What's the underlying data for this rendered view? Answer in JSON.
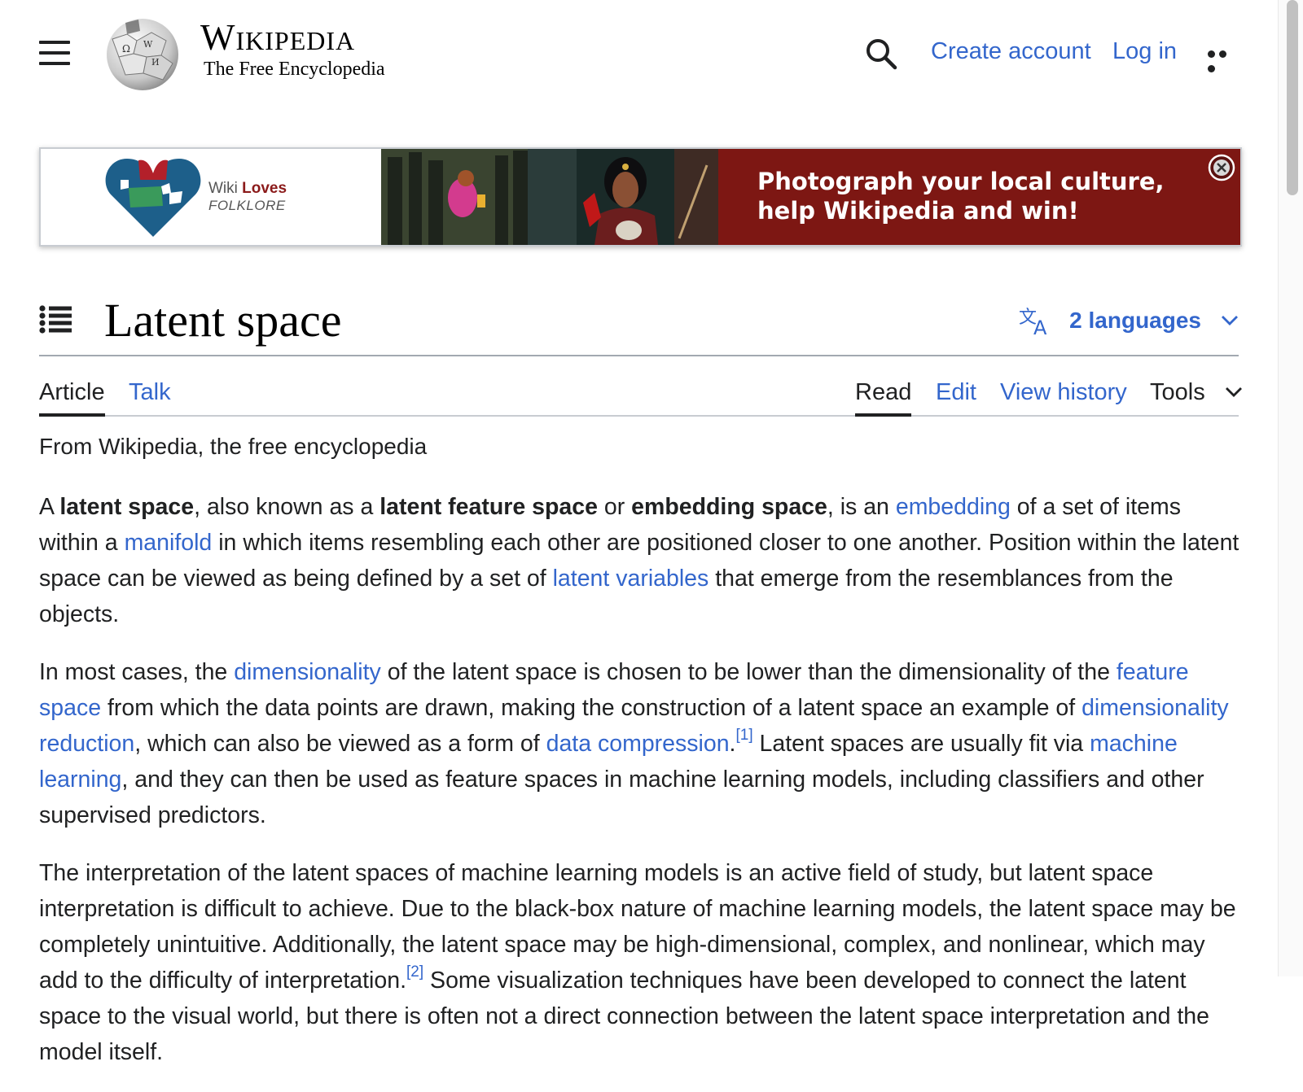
{
  "header": {
    "wordmark": "Wikipedia",
    "tagline": "The Free Encyclopedia",
    "create_account": "Create account",
    "log_in": "Log in"
  },
  "banner": {
    "logo_word1": "Wiki ",
    "logo_word2": "Loves",
    "logo_sub": "FOLKLORE",
    "cta": "Photograph your local culture, help Wikipedia and win!",
    "cta_bg": "#7d1713"
  },
  "article": {
    "title": "Latent space",
    "languages": "2 languages",
    "tabs": {
      "article": "Article",
      "talk": "Talk",
      "read": "Read",
      "edit": "Edit",
      "history": "View history",
      "tools": "Tools"
    },
    "from": "From Wikipedia, the free encyclopedia",
    "p1": {
      "t1": "A ",
      "b1": "latent space",
      "t2": ", also known as a ",
      "b2": "latent feature space",
      "t3": " or ",
      "b3": "embedding space",
      "t4": ", is an ",
      "l1": "embedding",
      "t5": " of a set of items within a ",
      "l2": "manifold",
      "t6": " in which items resembling each other are positioned closer to one another. Position within the latent space can be viewed as being defined by a set of ",
      "l3": "latent variables",
      "t7": " that emerge from the resemblances from the objects."
    },
    "p2": {
      "t1": "In most cases, the ",
      "l1": "dimensionality",
      "t2": " of the latent space is chosen to be lower than the dimensionality of the ",
      "l2": "feature space",
      "t3": " from which the data points are drawn, making the construction of a latent space an example of ",
      "l3": "dimensionality reduction",
      "t4": ", which can also be viewed as a form of ",
      "l4": "data compression",
      "t5": ".",
      "ref1": "[1]",
      "t6": " Latent spaces are usually fit via ",
      "l5": "machine learning",
      "t7": ", and they can then be used as feature spaces in machine learning models, including classifiers and other supervised predictors."
    },
    "p3": {
      "t1": "The interpretation of the latent spaces of machine learning models is an active field of study, but latent space interpretation is difficult to achieve. Due to the black-box nature of machine learning models, the latent space may be completely unintuitive. Additionally, the latent space may be high-dimensional, complex, and nonlinear, which may add to the difficulty of interpretation.",
      "ref2": "[2]",
      "t2": " Some visualization techniques have been developed to connect the latent space to the visual world, but there is often not a direct connection between the latent space interpretation and the model itself."
    }
  },
  "colors": {
    "link": "#3366cc",
    "text": "#202122",
    "border": "#a2a9b1"
  },
  "icons": [
    "menu-icon",
    "wikipedia-globe-icon",
    "search-icon",
    "more-icon",
    "close-icon",
    "toc-icon",
    "language-icon",
    "chevron-down-icon"
  ]
}
